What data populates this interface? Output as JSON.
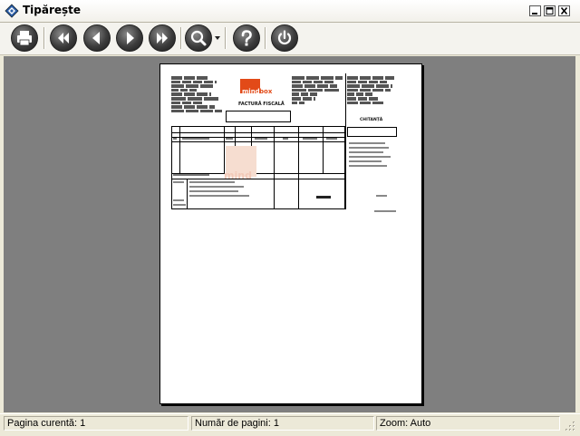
{
  "window": {
    "title": "Tipărește"
  },
  "toolbar": {
    "buttons": [
      {
        "icon": "printer-icon"
      },
      {
        "icon": "first-page-icon"
      },
      {
        "icon": "previous-page-icon"
      },
      {
        "icon": "next-page-icon"
      },
      {
        "icon": "last-page-icon"
      },
      {
        "icon": "zoom-icon"
      },
      {
        "icon": "help-icon"
      },
      {
        "icon": "power-icon"
      }
    ]
  },
  "document": {
    "logo_part1": "mind",
    "logo_part2": "box",
    "invoice_title": "FACTURĂ FISCALĂ",
    "receipt_title": "CHITANȚĂ"
  },
  "status": {
    "current_page_label": "Pagina curentă:",
    "current_page": "1",
    "page_count_label": "Număr de pagini:",
    "page_count": "1",
    "zoom_label": "Zoom:",
    "zoom_value": "Auto"
  },
  "colors": {
    "brand": "#e24a18",
    "preview_background": "#7f7f7f"
  }
}
